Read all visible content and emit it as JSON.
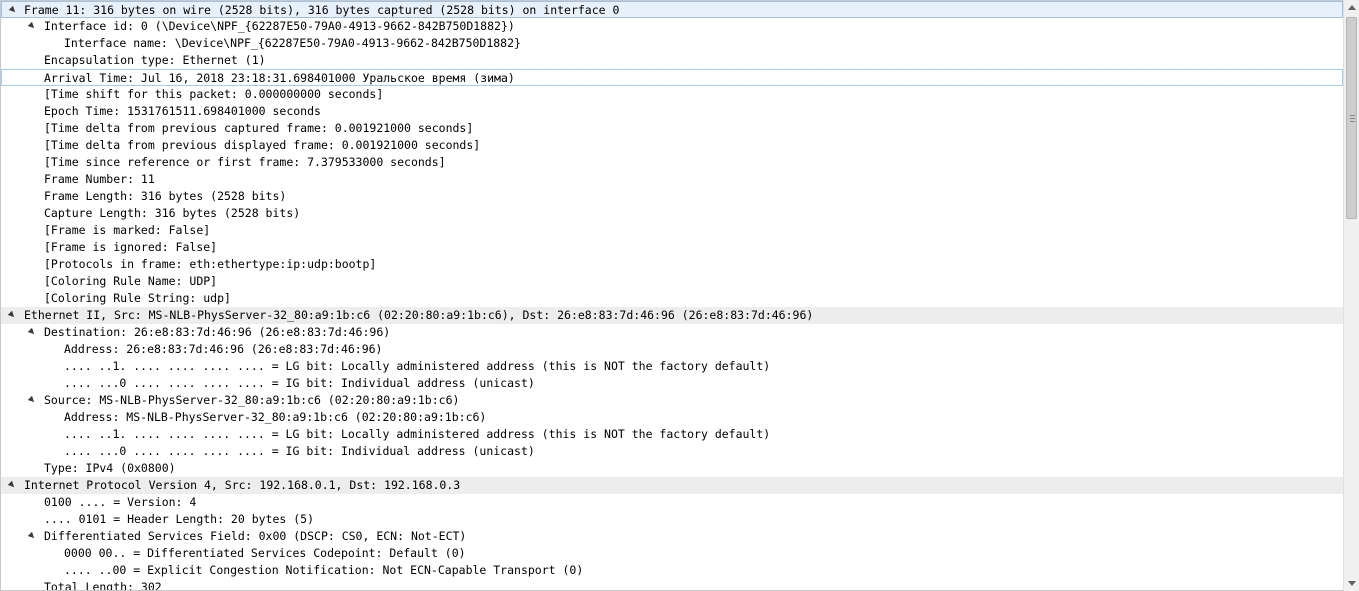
{
  "rows": [
    {
      "text": "Frame 11: 316 bytes on wire (2528 bits), 316 bytes captured (2528 bits) on interface 0",
      "level": 0,
      "expanded": true,
      "section": true,
      "selected": true
    },
    {
      "text": "Interface id: 0 (\\Device\\NPF_{62287E50-79A0-4913-9662-842B750D1882})",
      "level": 1,
      "expanded": true
    },
    {
      "text": "Interface name: \\Device\\NPF_{62287E50-79A0-4913-9662-842B750D1882}",
      "level": 2
    },
    {
      "text": "Encapsulation type: Ethernet (1)",
      "level": 1
    },
    {
      "text": "Arrival Time: Jul 16, 2018 23:18:31.698401000 Уральское время (зима)",
      "level": 1,
      "hover": true
    },
    {
      "text": "[Time shift for this packet: 0.000000000 seconds]",
      "level": 1
    },
    {
      "text": "Epoch Time: 1531761511.698401000 seconds",
      "level": 1
    },
    {
      "text": "[Time delta from previous captured frame: 0.001921000 seconds]",
      "level": 1
    },
    {
      "text": "[Time delta from previous displayed frame: 0.001921000 seconds]",
      "level": 1
    },
    {
      "text": "[Time since reference or first frame: 7.379533000 seconds]",
      "level": 1
    },
    {
      "text": "Frame Number: 11",
      "level": 1
    },
    {
      "text": "Frame Length: 316 bytes (2528 bits)",
      "level": 1
    },
    {
      "text": "Capture Length: 316 bytes (2528 bits)",
      "level": 1
    },
    {
      "text": "[Frame is marked: False]",
      "level": 1
    },
    {
      "text": "[Frame is ignored: False]",
      "level": 1
    },
    {
      "text": "[Protocols in frame: eth:ethertype:ip:udp:bootp]",
      "level": 1
    },
    {
      "text": "[Coloring Rule Name: UDP]",
      "level": 1
    },
    {
      "text": "[Coloring Rule String: udp]",
      "level": 1
    },
    {
      "text": "Ethernet II, Src: MS-NLB-PhysServer-32_80:a9:1b:c6 (02:20:80:a9:1b:c6), Dst: 26:e8:83:7d:46:96 (26:e8:83:7d:46:96)",
      "level": 0,
      "expanded": true,
      "section": true
    },
    {
      "text": "Destination: 26:e8:83:7d:46:96 (26:e8:83:7d:46:96)",
      "level": 1,
      "expanded": true
    },
    {
      "text": "Address: 26:e8:83:7d:46:96 (26:e8:83:7d:46:96)",
      "level": 2
    },
    {
      "text": ".... ..1. .... .... .... .... = LG bit: Locally administered address (this is NOT the factory default)",
      "level": 2
    },
    {
      "text": ".... ...0 .... .... .... .... = IG bit: Individual address (unicast)",
      "level": 2
    },
    {
      "text": "Source: MS-NLB-PhysServer-32_80:a9:1b:c6 (02:20:80:a9:1b:c6)",
      "level": 1,
      "expanded": true
    },
    {
      "text": "Address: MS-NLB-PhysServer-32_80:a9:1b:c6 (02:20:80:a9:1b:c6)",
      "level": 2
    },
    {
      "text": ".... ..1. .... .... .... .... = LG bit: Locally administered address (this is NOT the factory default)",
      "level": 2
    },
    {
      "text": ".... ...0 .... .... .... .... = IG bit: Individual address (unicast)",
      "level": 2
    },
    {
      "text": "Type: IPv4 (0x0800)",
      "level": 1
    },
    {
      "text": "Internet Protocol Version 4, Src: 192.168.0.1, Dst: 192.168.0.3",
      "level": 0,
      "expanded": true,
      "section": true
    },
    {
      "text": "0100 .... = Version: 4",
      "level": 1
    },
    {
      "text": ".... 0101 = Header Length: 20 bytes (5)",
      "level": 1
    },
    {
      "text": "Differentiated Services Field: 0x00 (DSCP: CS0, ECN: Not-ECT)",
      "level": 1,
      "expanded": true
    },
    {
      "text": "0000 00.. = Differentiated Services Codepoint: Default (0)",
      "level": 2
    },
    {
      "text": ".... ..00 = Explicit Congestion Notification: Not ECN-Capable Transport (0)",
      "level": 2
    },
    {
      "text": "Total Length: 302",
      "level": 1
    }
  ],
  "icons": {
    "expander": "expanded-triangle-icon",
    "scroll_up": "scroll-up-arrow-icon",
    "scroll_down": "scroll-down-arrow-icon"
  },
  "colors": {
    "section_bg": "#ededed",
    "selected_bg": "#e8f1fb",
    "selected_border": "#9fc3e6"
  }
}
